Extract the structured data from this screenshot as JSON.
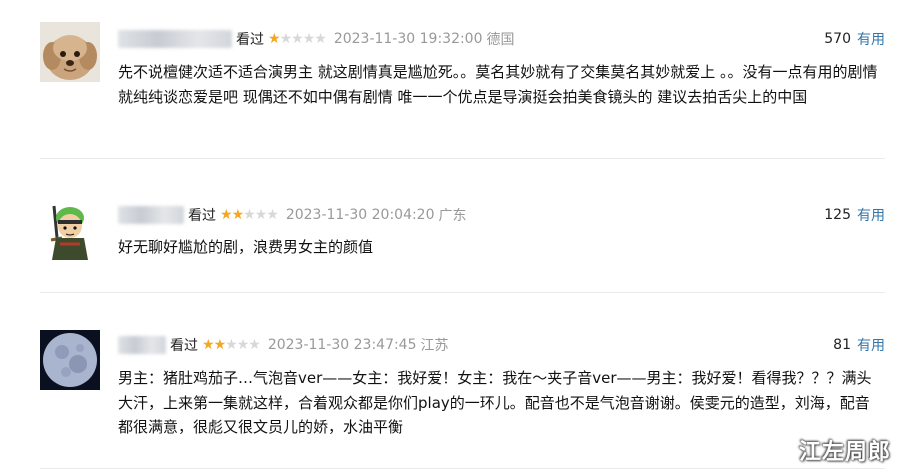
{
  "reviews": [
    {
      "status": "看过",
      "rating": 1,
      "date": "2023-11-30 19:32:00",
      "location": "德国",
      "votes": "570",
      "useful_label": "有用",
      "content": "先不说檀健次适不适合演男主 就这剧情真是尴尬死。。莫名其妙就有了交集莫名其妙就爱上 。。没有一点有用的剧情就纯纯谈恋爱是吧 现偶还不如中偶有剧情 唯一一个优点是导演挺会拍美食镜头的 建议去拍舌尖上的中国"
    },
    {
      "status": "看过",
      "rating": 2,
      "date": "2023-11-30 20:04:20",
      "location": "广东",
      "votes": "125",
      "useful_label": "有用",
      "content": "好无聊好尴尬的剧，浪费男女主的颜值"
    },
    {
      "status": "看过",
      "rating": 2,
      "date": "2023-11-30 23:47:45",
      "location": "江苏",
      "votes": "81",
      "useful_label": "有用",
      "content": "男主：猪肚鸡茄子…气泡音ver——女主：我好爱！女主：我在～夹子音ver——男主：我好爱！看得我？？？满头大汗，上来第一集就这样，合着观众都是你们play的一环儿。配音也不是气泡音谢谢。侯雯元的造型，刘海，配音都很满意，很彪又很文员儿的娇，水油平衡"
    }
  ],
  "colors": {
    "star_on": "#f5a623",
    "star_off": "#d8d8d8",
    "useful_link": "#3377aa",
    "meta_gray": "#999999"
  },
  "watermark": "江左周郎"
}
